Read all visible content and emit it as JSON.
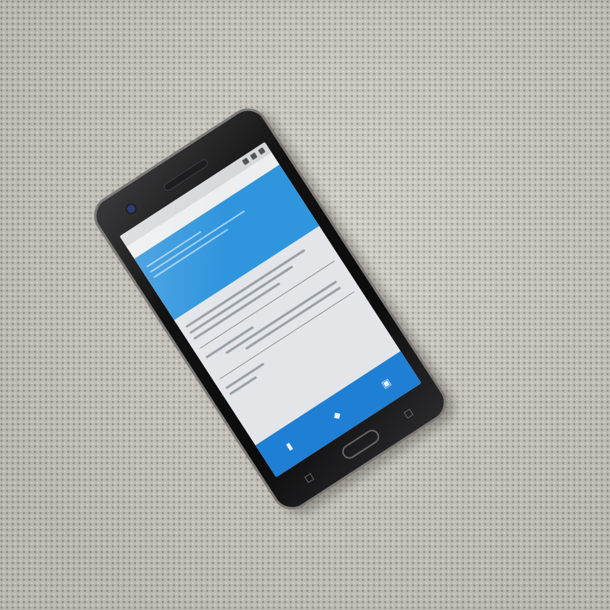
{
  "scene": {
    "surface": "textured-carpet",
    "surface_color": "#c9c5be",
    "object": "smartphone"
  },
  "phone": {
    "body_color": "#111111",
    "frame_color": "#7c7b78",
    "screen": {
      "app_bar_color": "#2f95dd",
      "bottom_bar_color": "#1f7fd4"
    },
    "hardware_buttons": [
      "back-icon",
      "home-button",
      "recent-apps-icon"
    ]
  }
}
